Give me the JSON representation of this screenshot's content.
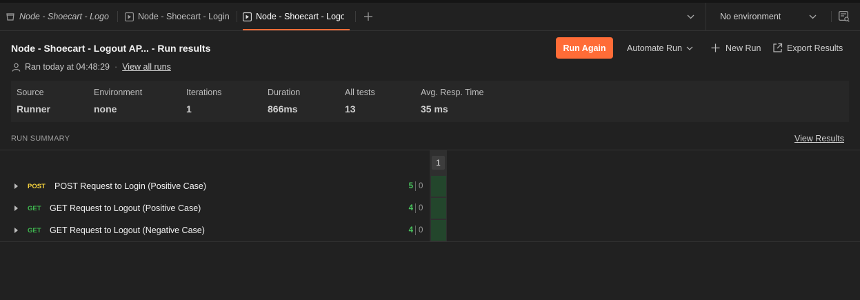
{
  "tabs": [
    {
      "label": "Node - Shoecart - Logout",
      "icon": "collection-icon",
      "italic": true,
      "active": false
    },
    {
      "label": "Node - Shoecart - Login",
      "icon": "runner-icon",
      "italic": false,
      "active": false
    },
    {
      "label": "Node - Shoecart - Logout",
      "icon": "runner-icon",
      "italic": false,
      "active": true
    }
  ],
  "environment": {
    "selected": "No environment"
  },
  "header": {
    "title": "Node - Shoecart - Logout AP... - Run results",
    "ran_at": "Ran today at 04:48:29",
    "separator": "·",
    "view_all_runs": "View all runs"
  },
  "actions": {
    "run_again": "Run Again",
    "automate_run": "Automate Run",
    "new_run": "New Run",
    "export_results": "Export Results"
  },
  "stats": [
    {
      "label": "Source",
      "value": "Runner"
    },
    {
      "label": "Environment",
      "value": "none"
    },
    {
      "label": "Iterations",
      "value": "1"
    },
    {
      "label": "Duration",
      "value": "866ms"
    },
    {
      "label": "All tests",
      "value": "13"
    },
    {
      "label": "Avg. Resp. Time",
      "value": "35 ms"
    }
  ],
  "summary": {
    "title": "RUN SUMMARY",
    "view_results": "View Results",
    "iteration_label": "1",
    "requests": [
      {
        "method": "POST",
        "name": "POST Request to Login (Positive Case)",
        "passed": "5",
        "failed": "0"
      },
      {
        "method": "GET",
        "name": "GET Request to Logout (Positive Case)",
        "passed": "4",
        "failed": "0"
      },
      {
        "method": "GET",
        "name": "GET Request to Logout (Negative Case)",
        "passed": "4",
        "failed": "0"
      }
    ]
  },
  "colors": {
    "accent": "#ff6c37",
    "pass": "#49c75f",
    "post_method": "#f4d13d",
    "get_method": "#3fb950",
    "pass_cell": "#23462c"
  }
}
